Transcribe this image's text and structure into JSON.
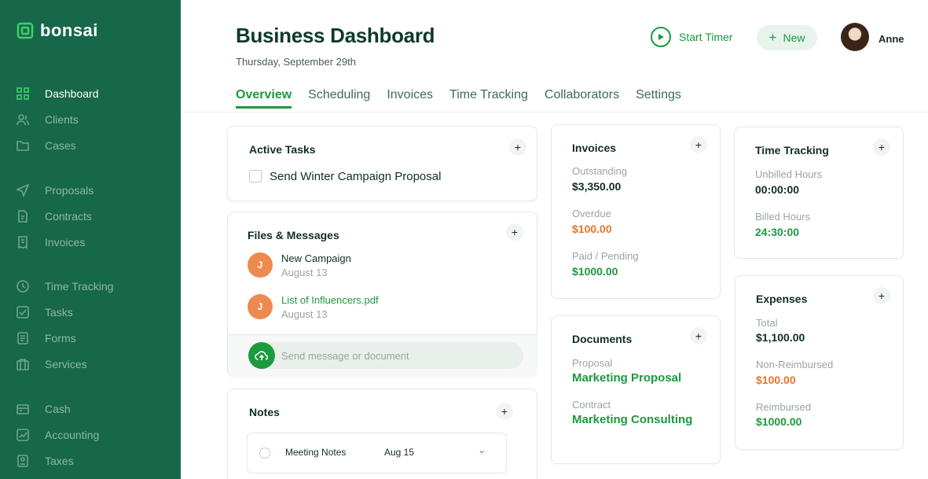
{
  "brand": {
    "name": "bonsai",
    "logo_icon": "bonsai-logo-icon"
  },
  "sidebar": {
    "items": [
      {
        "label": "Dashboard",
        "icon": "grid-icon",
        "active": true
      },
      {
        "label": "Clients",
        "icon": "users-icon"
      },
      {
        "label": "Cases",
        "icon": "folder-icon"
      },
      {
        "label": "Proposals",
        "icon": "send-icon"
      },
      {
        "label": "Contracts",
        "icon": "contract-icon"
      },
      {
        "label": "Invoices",
        "icon": "invoice-icon"
      },
      {
        "label": "Time Tracking",
        "icon": "clock-icon"
      },
      {
        "label": "Tasks",
        "icon": "check-square-icon"
      },
      {
        "label": "Forms",
        "icon": "form-icon"
      },
      {
        "label": "Services",
        "icon": "briefcase-icon"
      },
      {
        "label": "Cash",
        "icon": "wallet-icon"
      },
      {
        "label": "Accounting",
        "icon": "chart-icon"
      },
      {
        "label": "Taxes",
        "icon": "tax-icon"
      }
    ]
  },
  "header": {
    "title": "Business Dashboard",
    "date": "Thursday, September 29th",
    "start_timer": "Start Timer",
    "new_label": "New",
    "user_name": "Anne"
  },
  "tabs": [
    {
      "label": "Overview",
      "active": true
    },
    {
      "label": "Scheduling"
    },
    {
      "label": "Invoices"
    },
    {
      "label": "Time Tracking"
    },
    {
      "label": "Collaborators"
    },
    {
      "label": "Settings"
    }
  ],
  "active_tasks": {
    "title": "Active Tasks",
    "items": [
      {
        "label": "Send Winter Campaign Proposal",
        "done": false
      }
    ]
  },
  "files_messages": {
    "title": "Files & Messages",
    "items": [
      {
        "initial": "J",
        "name": "New Campaign",
        "date": "August 13"
      },
      {
        "initial": "J",
        "name": "List of Influencers.pdf",
        "date": "August 13"
      }
    ],
    "message_placeholder": "Send message or document"
  },
  "notes": {
    "title": "Notes",
    "items": [
      {
        "name": "Meeting Notes",
        "date": "Aug 15"
      }
    ]
  },
  "invoices": {
    "title": "Invoices",
    "outstanding_label": "Outstanding",
    "outstanding_value": "$3,350.00",
    "overdue_label": "Overdue",
    "overdue_value": "$100.00",
    "paid_label": "Paid / Pending",
    "paid_value": "$1000.00"
  },
  "documents": {
    "title": "Documents",
    "proposal_label": "Proposal",
    "proposal_value": "Marketing Proposal",
    "contract_label": "Contract",
    "contract_value": "Marketing Consulting"
  },
  "time_tracking": {
    "title": "Time Tracking",
    "unbilled_label": "Unbilled Hours",
    "unbilled_value": "00:00:00",
    "billed_label": "Billed Hours",
    "billed_value": "24:30:00"
  },
  "expenses": {
    "title": "Expenses",
    "total_label": "Total",
    "total_value": "$1,100.00",
    "non_reimbursed_label": "Non-Reimbursed",
    "non_reimbursed_value": "$100.00",
    "reimbursed_label": "Reimbursed",
    "reimbursed_value": "$1000.00"
  },
  "colors": {
    "sidebar": "#17674a",
    "accent": "#1b9a3e",
    "warning": "#e8742a"
  }
}
